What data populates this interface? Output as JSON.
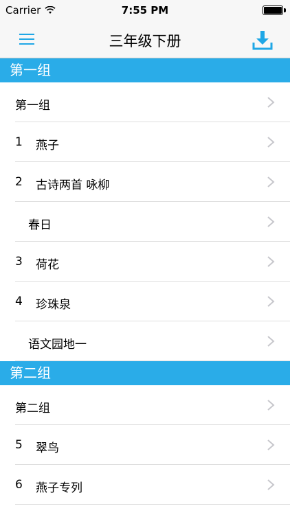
{
  "status_bar": {
    "carrier": "Carrier",
    "time": "7:55 PM"
  },
  "nav": {
    "title": "三年级下册",
    "accent_color": "#1fa7e6"
  },
  "sections": [
    {
      "header": "第一组",
      "rows": [
        {
          "num": "",
          "label": "第一组"
        },
        {
          "num": "1",
          "label": "燕子"
        },
        {
          "num": "2",
          "label": "古诗两首 咏柳"
        },
        {
          "num": "",
          "label": "春日"
        },
        {
          "num": "3",
          "label": "荷花"
        },
        {
          "num": "4",
          "label": "珍珠泉"
        },
        {
          "num": "",
          "label": "语文园地一"
        }
      ]
    },
    {
      "header": "第二组",
      "rows": [
        {
          "num": "",
          "label": "第二组"
        },
        {
          "num": "5",
          "label": "翠鸟"
        },
        {
          "num": "6",
          "label": "燕子专列"
        }
      ]
    }
  ]
}
